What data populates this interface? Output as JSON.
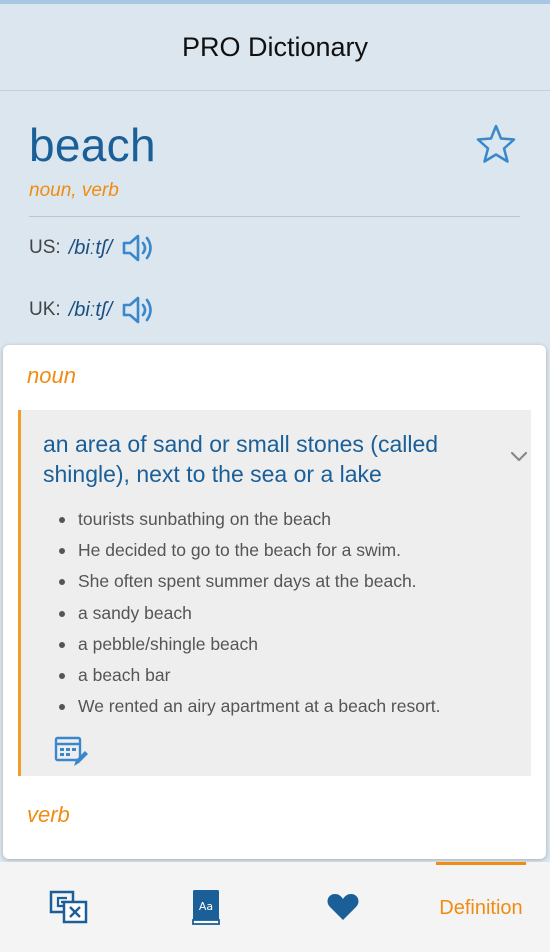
{
  "app": {
    "title": "PRO Dictionary"
  },
  "entry": {
    "word": "beach",
    "parts_of_speech": "noun, verb",
    "pronunciations": [
      {
        "region": "US:",
        "ipa": "/biːtʃ/"
      },
      {
        "region": "UK:",
        "ipa": "/biːtʃ/"
      }
    ]
  },
  "senses_card": {
    "noun_label": "noun",
    "definition": "an area of sand or small stones (called shingle), next to the sea or a lake",
    "examples": [
      "tourists sunbathing on the beach",
      "He decided to go to the beach for a swim.",
      "She often spent summer days at the beach.",
      "a sandy beach",
      "a pebble/shingle beach",
      "a beach bar",
      "We rented an airy apartment at a beach resort."
    ],
    "verb_label": "verb"
  },
  "bottom_nav": {
    "items": [
      {
        "icon": "translate-icon"
      },
      {
        "icon": "dictionary-book-icon"
      },
      {
        "icon": "heart-icon"
      },
      {
        "label": "Definition",
        "active": true
      }
    ]
  },
  "colors": {
    "accent_orange": "#f08c12",
    "primary_blue": "#1b5f98",
    "header_bg": "#dbe6ef"
  }
}
